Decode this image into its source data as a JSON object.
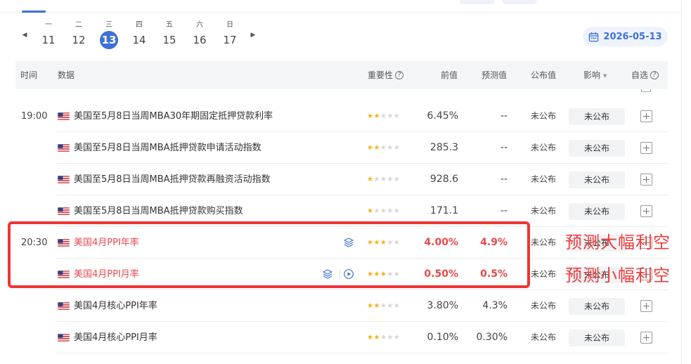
{
  "week": {
    "days": [
      {
        "weekday": "一",
        "day": "11"
      },
      {
        "weekday": "二",
        "day": "12"
      },
      {
        "weekday": "三",
        "day": "13"
      },
      {
        "weekday": "四",
        "day": "14"
      },
      {
        "weekday": "五",
        "day": "15"
      },
      {
        "weekday": "六",
        "day": "16"
      },
      {
        "weekday": "日",
        "day": "17"
      }
    ],
    "active_day": "13",
    "prev_arrow": "◀",
    "next_arrow": "▶"
  },
  "date_picker": {
    "value": "2026-05-13",
    "icon": "calendar-icon"
  },
  "table": {
    "headers": {
      "time": "时间",
      "data": "数据",
      "importance": "重要性",
      "previous": "前值",
      "forecast": "预测值",
      "actual": "公布值",
      "impact": "影响",
      "watchlist": "自选"
    },
    "help_glyph": "?",
    "sort_glyph": "▼",
    "rows": [
      {
        "time": "19:00",
        "country": "美国",
        "name": "美国至5月8日当周MBA30年期固定抵押贷款利率",
        "stars": 2,
        "previous": "6.45%",
        "forecast": "--",
        "actual": "未公布",
        "impact": "未公布",
        "highlight": false
      },
      {
        "time": "",
        "country": "美国",
        "name": "美国至5月8日当周MBA抵押贷款申请活动指数",
        "stars": 2,
        "previous": "285.3",
        "forecast": "--",
        "actual": "未公布",
        "impact": "未公布",
        "highlight": false
      },
      {
        "time": "",
        "country": "美国",
        "name": "美国至5月8日当周MBA抵押贷款再融资活动指数",
        "stars": 1,
        "previous": "928.6",
        "forecast": "--",
        "actual": "未公布",
        "impact": "未公布",
        "highlight": false
      },
      {
        "time": "",
        "country": "美国",
        "name": "美国至5月8日当周MBA抵押贷款购买指数",
        "stars": 1,
        "previous": "171.1",
        "forecast": "--",
        "actual": "未公布",
        "impact": "未公布",
        "highlight": false
      },
      {
        "time": "20:30",
        "country": "美国",
        "name": "美国4月PPI年率",
        "stars": 3,
        "previous": "4.00%",
        "forecast": "4.9%",
        "actual": "未公布",
        "impact": "未公布",
        "highlight": true,
        "icons": [
          "layers-icon"
        ]
      },
      {
        "time": "",
        "country": "美国",
        "name": "美国4月PPI月率",
        "stars": 3,
        "previous": "0.50%",
        "forecast": "0.5%",
        "actual": "未公布",
        "impact": "未公布",
        "highlight": true,
        "icons": [
          "layers-icon",
          "play-circle-icon"
        ]
      },
      {
        "time": "",
        "country": "美国",
        "name": "美国4月核心PPI年率",
        "stars": 2,
        "previous": "3.80%",
        "forecast": "4.3%",
        "actual": "未公布",
        "impact": "未公布",
        "highlight": false
      },
      {
        "time": "",
        "country": "美国",
        "name": "美国4月核心PPI月率",
        "stars": 2,
        "previous": "0.10%",
        "forecast": "0.30%",
        "actual": "未公布",
        "impact": "未公布",
        "highlight": false
      }
    ]
  },
  "annotations": {
    "line1": "预测大幅利空",
    "line2": "预测小幅利空"
  },
  "colors": {
    "accent": "#3f6fd8",
    "highlight": "#e8494a",
    "annotation": "#ef3b3b",
    "star_on": "#f4b218",
    "star_off": "#d6d6d6"
  }
}
